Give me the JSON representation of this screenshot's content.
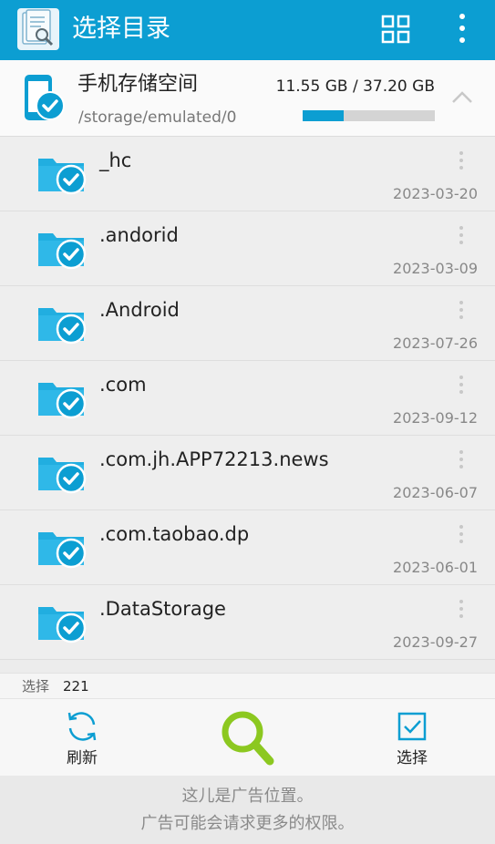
{
  "appbar": {
    "title": "选择目录",
    "icons": {
      "app": "document-search-icon",
      "grid": "grid-view-icon",
      "more": "more-vert-icon"
    }
  },
  "storage": {
    "name": "手机存储空间",
    "path": "/storage/emulated/0",
    "usage_text": "11.55 GB / 37.20 GB",
    "used_fraction": 0.31,
    "icon": "phone-check-icon"
  },
  "folders": [
    {
      "name": "_hc",
      "date": "2023-03-20"
    },
    {
      "name": ".andorid",
      "date": "2023-03-09"
    },
    {
      "name": ".Android",
      "date": "2023-07-26"
    },
    {
      "name": ".com",
      "date": "2023-09-12"
    },
    {
      "name": ".com.jh.APP72213.news",
      "date": "2023-06-07"
    },
    {
      "name": ".com.taobao.dp",
      "date": "2023-06-01"
    },
    {
      "name": ".DataStorage",
      "date": "2023-09-27"
    }
  ],
  "selection": {
    "label": "选择",
    "count": "221"
  },
  "toolbar": {
    "refresh_label": "刷新",
    "select_label": "选择"
  },
  "ad": {
    "line1": "这儿是广告位置。",
    "line2": "广告可能会请求更多的权限。"
  },
  "colors": {
    "primary": "#0c9ed2",
    "search_green": "#8cc820"
  }
}
